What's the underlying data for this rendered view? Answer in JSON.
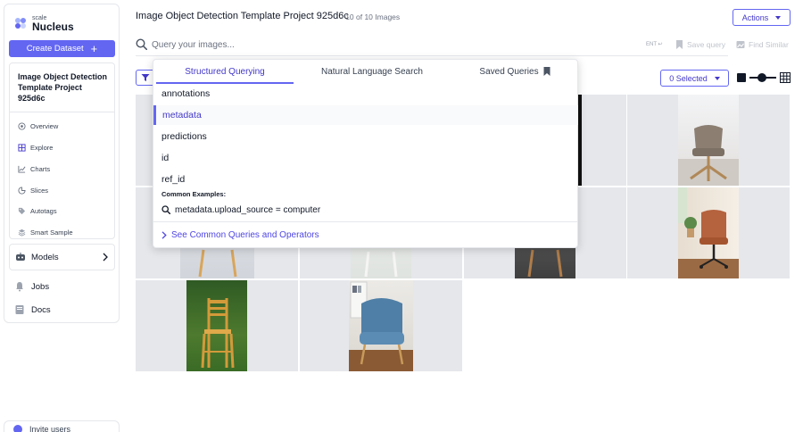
{
  "brand": {
    "small": "scale",
    "name": "Nucleus"
  },
  "sidebar": {
    "create_label": "Create Dataset",
    "project_title": "Image Object Detection Template Project 925d6c",
    "nav": [
      {
        "label": "Overview",
        "icon": "overview-icon"
      },
      {
        "label": "Explore",
        "icon": "grid-icon"
      },
      {
        "label": "Charts",
        "icon": "chart-icon"
      },
      {
        "label": "Slices",
        "icon": "slices-icon"
      },
      {
        "label": "Autotags",
        "icon": "tag-icon"
      },
      {
        "label": "Smart Sample",
        "icon": "layers-icon"
      }
    ],
    "models_label": "Models",
    "jobs_label": "Jobs",
    "docs_label": "Docs",
    "invite_label": "Invite users"
  },
  "header": {
    "title": "Image Object Detection Template Project 925d6c",
    "subtitle": "- 10 of 10 Images",
    "actions_label": "Actions"
  },
  "search": {
    "placeholder": "Query your images...",
    "enter_hint": "ENT ↩",
    "save_label": "Save query",
    "find_similar_label": "Find Similar"
  },
  "toolbar": {
    "selected_label": "0 Selected"
  },
  "dropdown": {
    "tabs": [
      "Structured Querying",
      "Natural Language Search",
      "Saved Queries"
    ],
    "active_tab": 0,
    "fields": [
      "annotations",
      "metadata",
      "predictions",
      "id",
      "ref_id"
    ],
    "active_field": 1,
    "examples_heading": "Common Examples:",
    "example_query": "metadata.upload_source = computer",
    "see_link": "See Common Queries and Operators"
  },
  "colors": {
    "accent": "#6366f1",
    "accent_text": "#4338ca",
    "placeholder_bg": "#e5e7eb"
  }
}
